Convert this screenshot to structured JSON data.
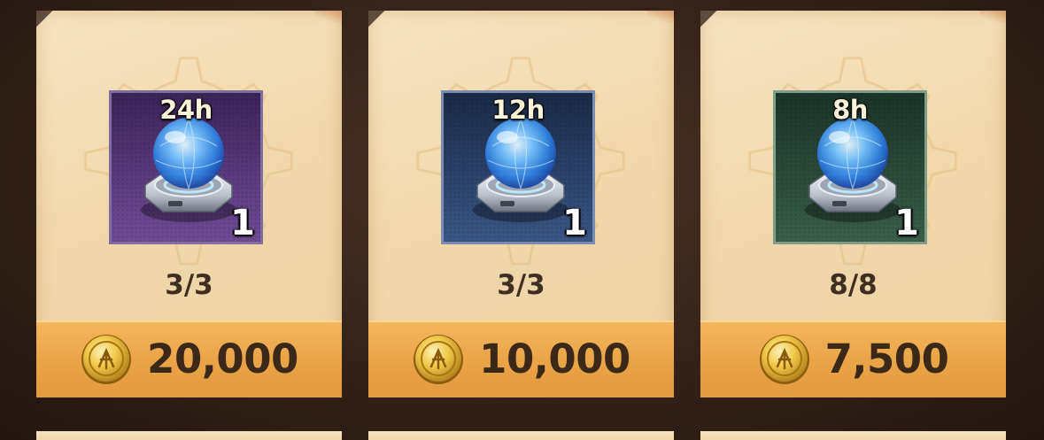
{
  "shop": {
    "items": [
      {
        "duration": "24h",
        "quantity": "1",
        "stock": "3/3",
        "price": "20,000",
        "rarity": "purple",
        "icon": "shield-orb-device-icon"
      },
      {
        "duration": "12h",
        "quantity": "1",
        "stock": "3/3",
        "price": "10,000",
        "rarity": "blue",
        "icon": "shield-orb-device-icon"
      },
      {
        "duration": "8h",
        "quantity": "1",
        "stock": "8/8",
        "price": "7,500",
        "rarity": "green",
        "icon": "shield-orb-device-icon"
      }
    ],
    "currency_icon": "gold-coin-icon",
    "colors": {
      "card_bg": "#f2dcb0",
      "price_bar": "#eaa548",
      "text_dark": "#3f2f1f",
      "purple_frame": "#5a3a7e",
      "blue_frame": "#2c426a",
      "green_frame": "#2c4a3a"
    }
  }
}
